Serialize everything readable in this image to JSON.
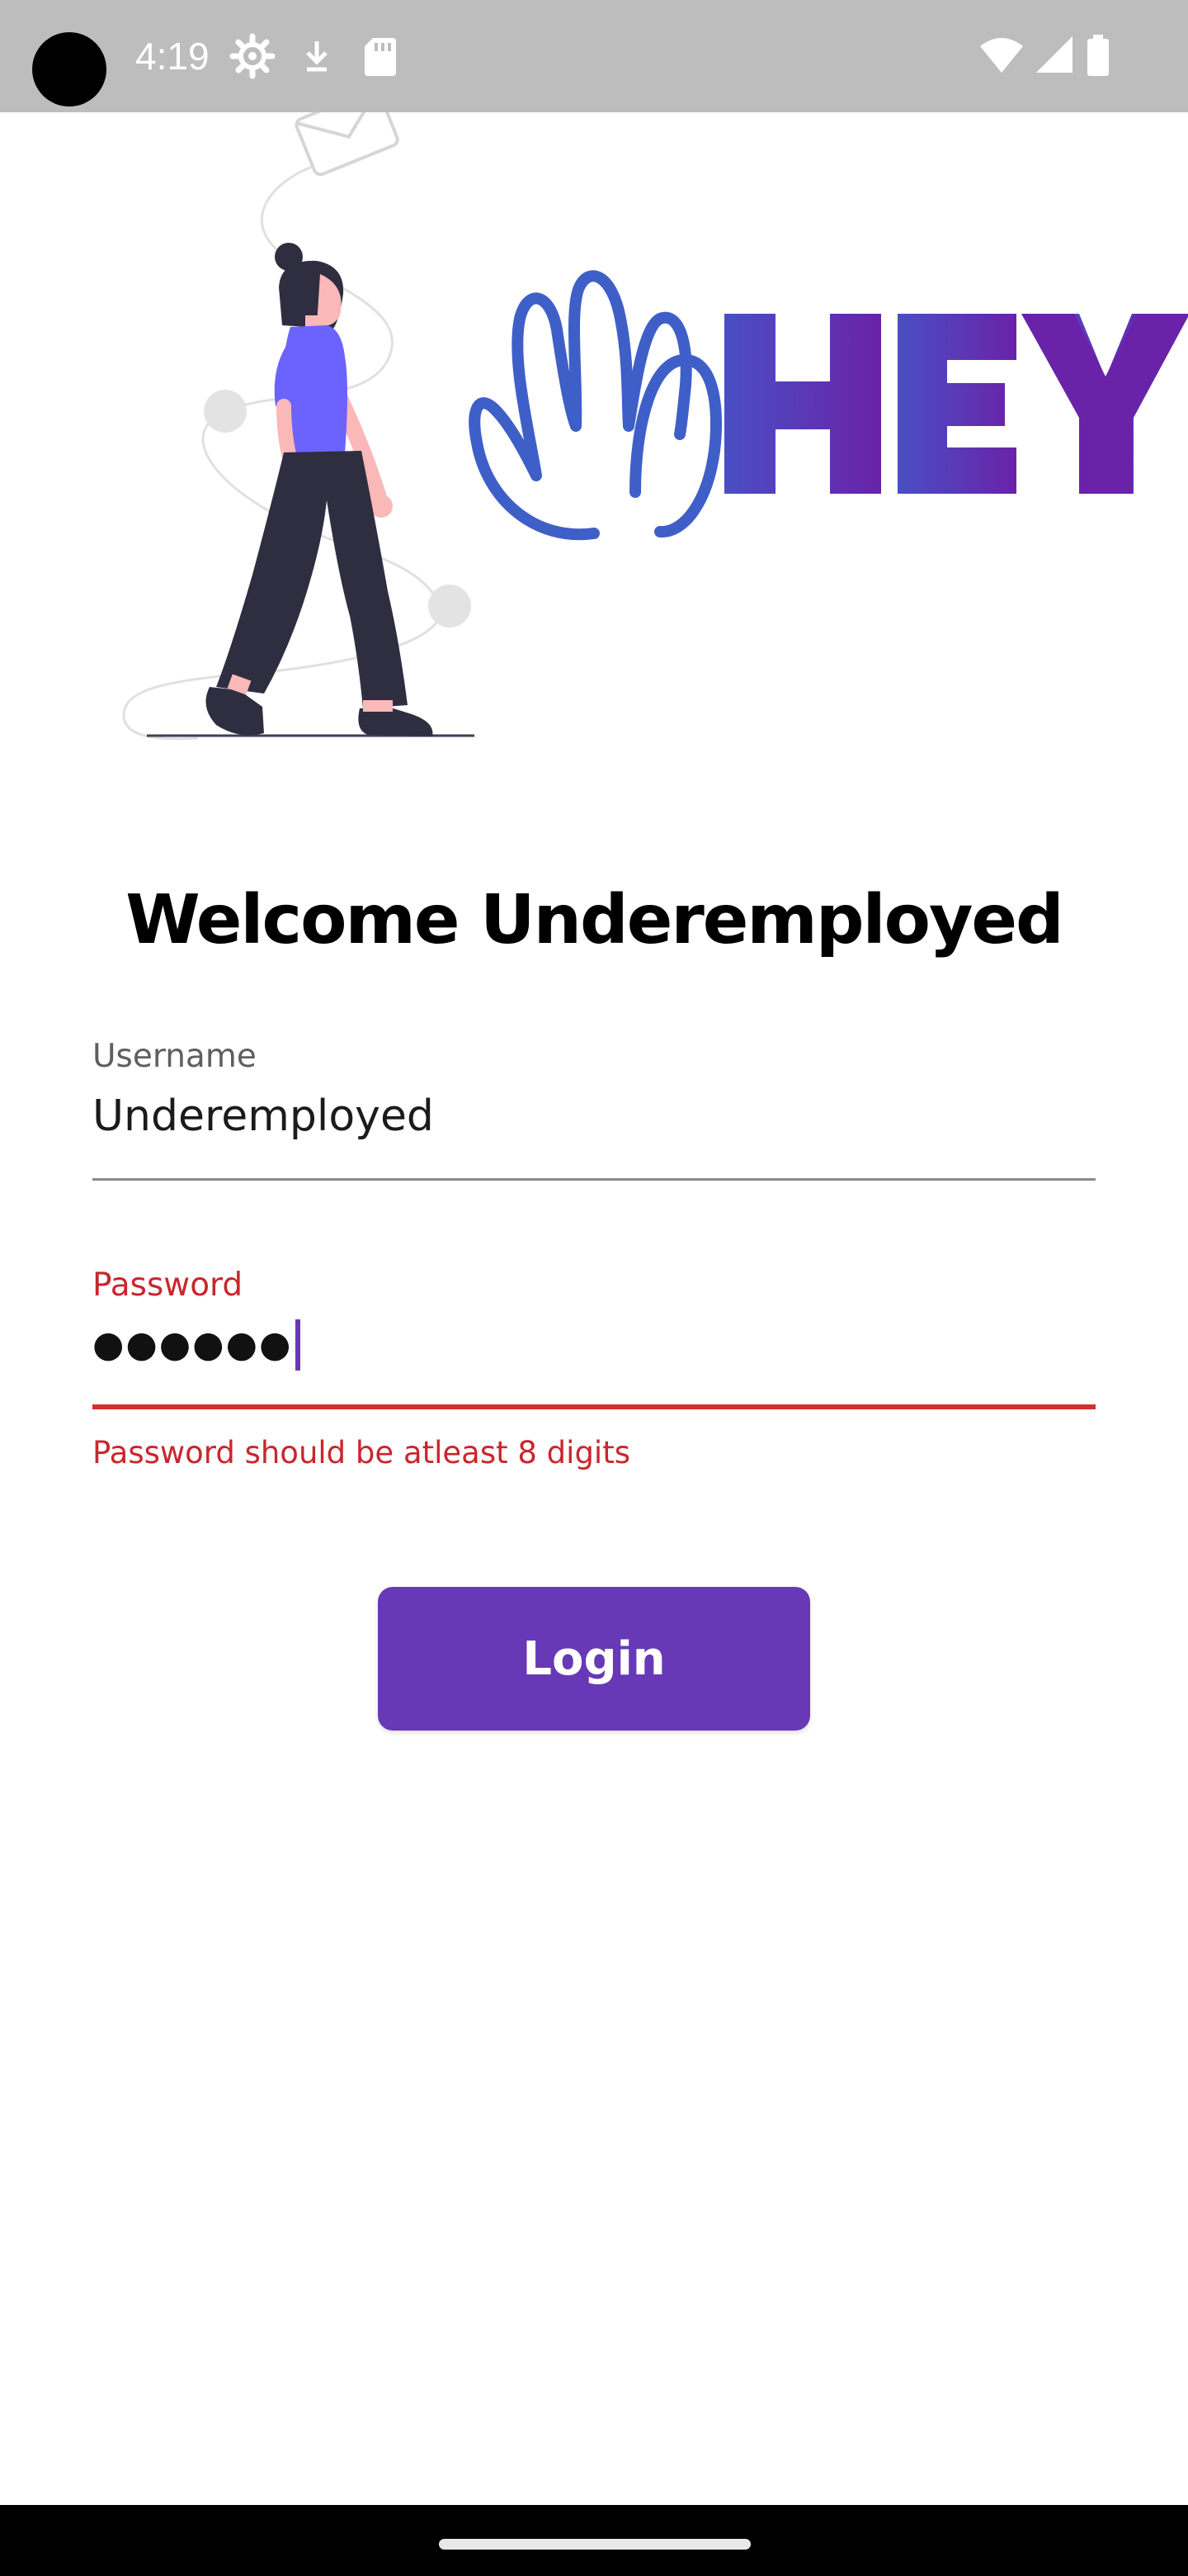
{
  "status_bar": {
    "time": "4:19",
    "icons": [
      "settings-gear-icon",
      "download-icon",
      "sd-card-icon",
      "wifi-icon",
      "cell-signal-icon",
      "battery-icon"
    ]
  },
  "hero": {
    "logo_text": "HEY",
    "illustration": "woman-walking-illustration",
    "colors": {
      "hand": "#3f5fc8",
      "logo_start": "#4a4fc4",
      "logo_end": "#6a22a8",
      "shirt": "#6c63ff",
      "pants": "#2f2e41"
    }
  },
  "title": "Welcome Underemployed",
  "username": {
    "label": "Username",
    "value": "Underemployed"
  },
  "password": {
    "label": "Password",
    "masked_value": "●●●●●●",
    "error": "Password should be atleast 8 digits"
  },
  "login_button": {
    "label": "Login"
  },
  "colors": {
    "accent": "#6739b7",
    "error": "#d32f2f",
    "status_bar": "#bdbdbd"
  }
}
